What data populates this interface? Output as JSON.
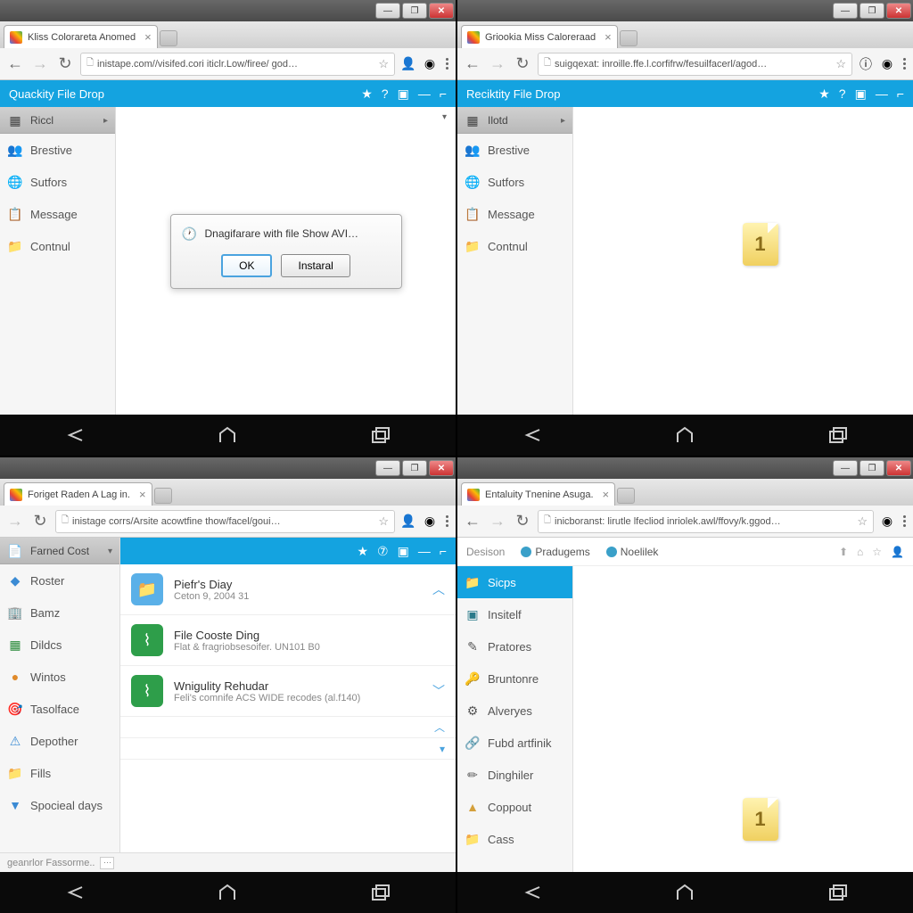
{
  "p1": {
    "tab": "Kliss Colorareta Anomed",
    "url": "inistape.com//visifed.cori iticlr.Low/firee/ god…",
    "app": "Quackity File Drop",
    "hd": "Riccl",
    "items": [
      "Brestive",
      "Sutfors",
      "Message",
      "Contnul"
    ],
    "dlg": {
      "msg": "Dnagifarare with file Show AVI…",
      "ok": "OK",
      "ins": "Instaral"
    }
  },
  "p2": {
    "tab": "Griookia Miss Caloreraad",
    "url": "suigqexat: inroille.ffe.l.corfifrw/fesuilfacerl/agod…",
    "app": "Reciktity File Drop",
    "hd": "Ilotd",
    "items": [
      "Brestive",
      "Sutfors",
      "Message",
      "Contnul"
    ],
    "badge": "1"
  },
  "p3": {
    "tab": "Foriget Raden A Lag in.",
    "url": "inistage corrs/Arsite acowtfine thow/facel/goui…",
    "hd": "Farned Cost",
    "items": [
      "Roster",
      "Bamz",
      "Dildcs",
      "Wintos",
      "Tasolface",
      "Depother",
      "Fills",
      "Spocieal days"
    ],
    "foot": "geanrlor Fassorme..",
    "list": [
      {
        "t": "Piefr's Diay",
        "s": "Ceton 9, 2004 31"
      },
      {
        "t": "File Cooste Ding",
        "s": "Flat & fragriobsesoifer. UN101 B0"
      },
      {
        "t": "Wnigulity Rehudar",
        "s": "Feli's comnife ACS WIDE recodes (al.f140)"
      }
    ]
  },
  "p4": {
    "tab": "Entaluity Tnenine Asuga.",
    "url": "inicboranst: lirutle lfecliod inriolek.awl/ffovy/k.ggod…",
    "nav": {
      "brand": "Desison",
      "a": "Pradugems",
      "b": "Noelilek"
    },
    "hd": "Sicps",
    "items": [
      "Insitelf",
      "Pratores",
      "Bruntonre",
      "Alveryes",
      "Fubd artfinik",
      "Dinghiler",
      "Coppout",
      "Cass"
    ],
    "badge": "1"
  }
}
